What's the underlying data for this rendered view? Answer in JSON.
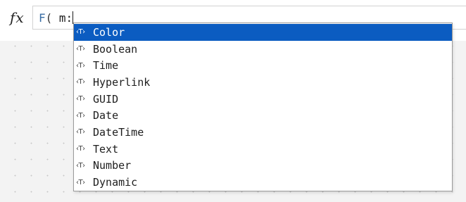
{
  "formula_bar": {
    "fx_label": "fx",
    "tokens": {
      "function": "F",
      "paren": "( ",
      "arg": "m:"
    }
  },
  "autocomplete": {
    "type_icon": "‹T›",
    "selected_index": 0,
    "selected_color": "#0b5cc1",
    "items": [
      {
        "label": "Color"
      },
      {
        "label": "Boolean"
      },
      {
        "label": "Time"
      },
      {
        "label": "Hyperlink"
      },
      {
        "label": "GUID"
      },
      {
        "label": "Date"
      },
      {
        "label": "DateTime"
      },
      {
        "label": "Text"
      },
      {
        "label": "Number"
      },
      {
        "label": "Dynamic"
      }
    ]
  }
}
